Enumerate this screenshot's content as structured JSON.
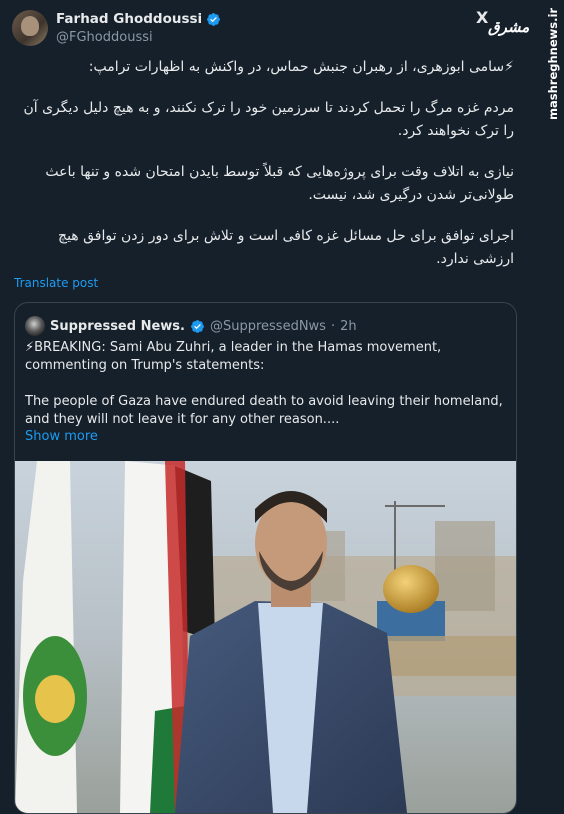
{
  "author": {
    "display_name": "Farhad Ghoddoussi",
    "handle": "@FGhoddoussi",
    "verified_icon": "verified-badge-icon"
  },
  "brand": {
    "x_logo": "X",
    "source_logo": "مشرق",
    "watermark": "mashreghnews.ir"
  },
  "tweet": {
    "paragraphs": [
      "⚡سامی ابوزهری، از رهبران جنبش حماس، در واکنش به اظهارات ترامپ:",
      "مردم غزه مرگ را تحمل کردند تا سرزمین خود را ترک نکنند، و به هیچ دلیل دیگری آن را ترک نخواهند کرد.",
      "نیازی به اتلاف وقت برای پروژه‌هایی که قبلاً توسط بایدن امتحان شده و تنها باعث طولانی‌تر شدن درگیری شد، نیست.",
      "اجرای توافق برای حل مسائل غزه کافی است و تلاش برای دور زدن توافق هیچ ارزشی ندارد."
    ],
    "translate_label": "Translate post"
  },
  "quote": {
    "display_name": "Suppressed News.",
    "handle": "@SuppressedNws",
    "separator": "·",
    "time": "2h",
    "paragraphs": [
      "⚡BREAKING: Sami Abu Zuhri, a leader in the Hamas movement, commenting on Trump's statements:",
      "The people of Gaza have endured death to avoid leaving their homeland, and they will not leave it for any other reason...."
    ],
    "show_more_label": "Show more"
  },
  "colors": {
    "background": "#15202b",
    "text": "#e7e9ea",
    "secondary": "#8b98a5",
    "accent": "#1d9bf0",
    "border": "#38444d"
  }
}
